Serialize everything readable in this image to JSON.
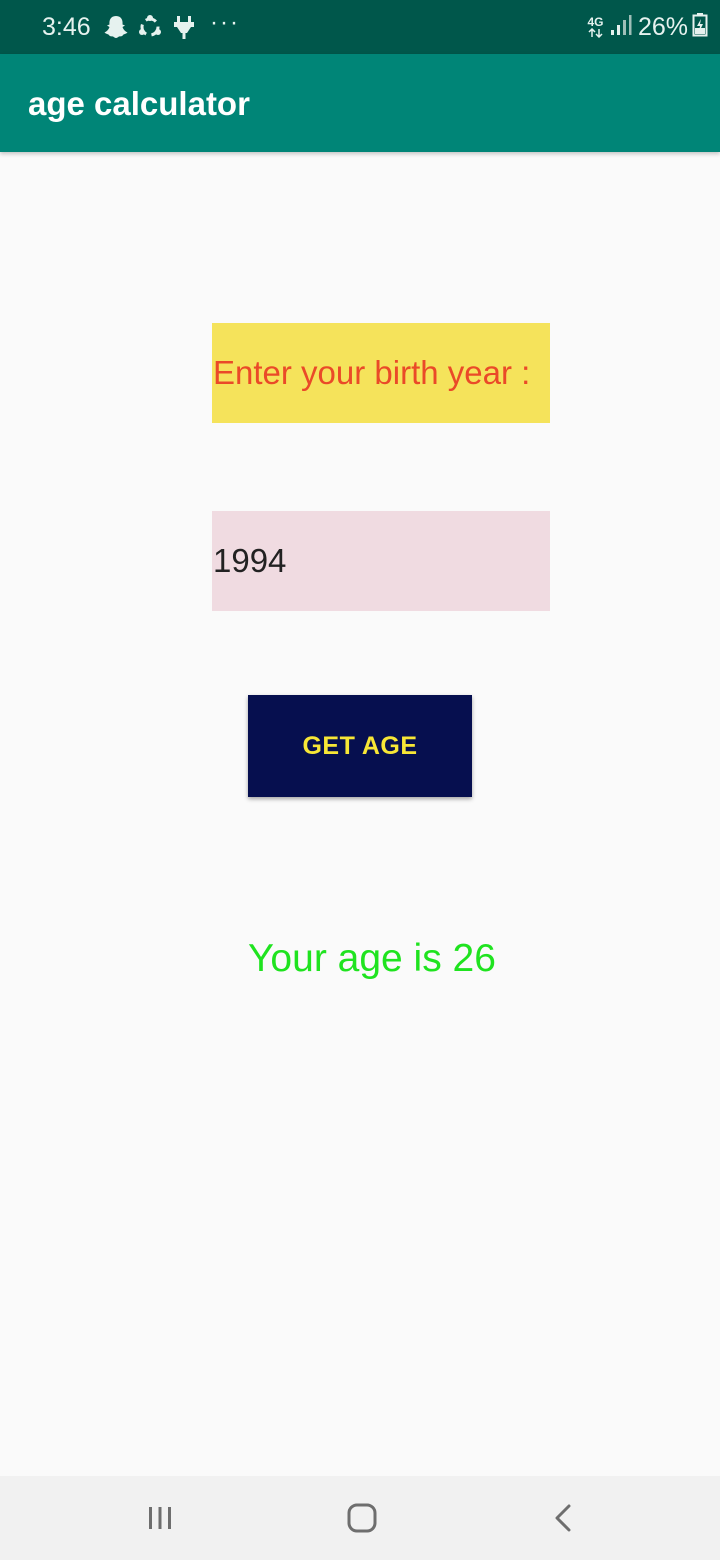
{
  "status_bar": {
    "time": "3:46",
    "dots": "···",
    "network_type": "4G",
    "battery_percent": "26%",
    "icons": [
      "snapchat-ghost-icon",
      "sync-icon",
      "usb-plug-icon",
      "network-4g-icon",
      "signal-icon",
      "battery-charging-icon"
    ]
  },
  "app_bar": {
    "title": "age calculator"
  },
  "form": {
    "prompt_label": "Enter your birth year :",
    "year_value": "1994",
    "button_label": "GET AGE",
    "result": "Your age is 26"
  },
  "nav_bar": {
    "icons": [
      "recent-apps-icon",
      "home-icon",
      "back-icon"
    ]
  },
  "colors": {
    "status_bar": "#00574B",
    "app_bar": "#008577",
    "prompt_background": "#F5E35B",
    "prompt_text": "#EA4A28",
    "input_background": "#F0DBE1",
    "button_background": "#060F4F",
    "button_text": "#F7E636",
    "result_text": "#1FE31F"
  }
}
